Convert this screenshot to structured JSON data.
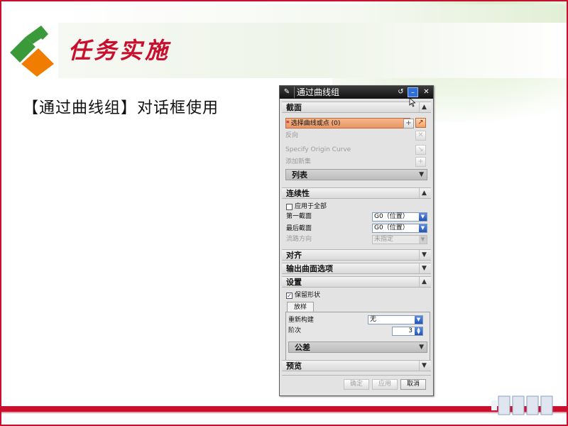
{
  "slide": {
    "title": "任务实施",
    "body_text": "【通过曲线组】对话框使用"
  },
  "dialog": {
    "title": "通过曲线组",
    "title_icon": "wrench-icon",
    "buttons": {
      "reset": "↺",
      "minimize": "–",
      "close": "✕"
    },
    "sections": {
      "section1": {
        "label": "截面",
        "select_row": "选择曲线或点 (0)",
        "reverse_label": "反向",
        "origin_label": "Specify Origin Curve",
        "add_set_label": "添加新集",
        "list_label": "列表"
      },
      "continuity": {
        "label": "连续性",
        "apply_all_label": "应用于全部",
        "first_label": "第一截面",
        "first_value": "G0（位置）",
        "last_label": "最后截面",
        "last_value": "G0（位置）",
        "flow_label": "流路方向",
        "flow_value": "未指定"
      },
      "align": {
        "label": "对齐"
      },
      "output": {
        "label": "输出曲面选项"
      },
      "settings": {
        "label": "设置",
        "keep_shape_label": "保留形状",
        "tab_label": "放样",
        "rebuild_label": "重新构建",
        "rebuild_value": "无",
        "degree_label": "阶次",
        "degree_value": "3",
        "tolerance_label": "公差"
      },
      "preview": {
        "label": "预览"
      }
    },
    "footer": {
      "ok": "确定",
      "apply": "应用",
      "cancel": "取消"
    }
  },
  "colors": {
    "brand_red": "#c8102e",
    "brand_green": "#3a9a3a",
    "brand_orange": "#f07d00",
    "selection_orange": "#e99564",
    "dropdown_blue": "#2554b8"
  }
}
